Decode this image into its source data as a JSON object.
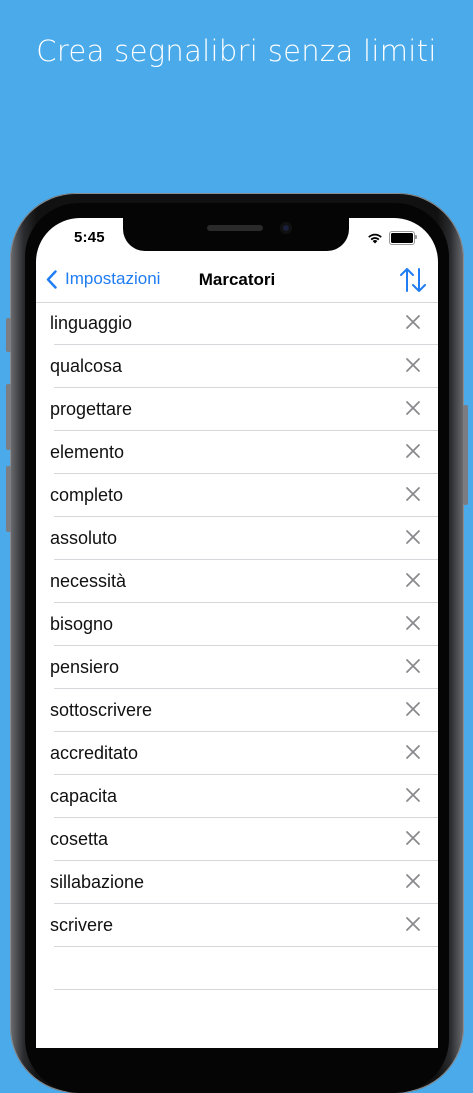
{
  "headline": "Crea segnalibri senza limiti",
  "status_bar": {
    "time": "5:45"
  },
  "nav": {
    "back_label": "Impostazioni",
    "title": "Marcatori",
    "sort_icon": "sort-arrows-icon"
  },
  "bookmarks": [
    "linguaggio",
    "qualcosa",
    "progettare",
    "elemento",
    "completo",
    "assoluto",
    "necessità",
    "bisogno",
    "pensiero",
    "sottoscrivere",
    "accreditato",
    "capacita",
    "cosetta",
    "sillabazione",
    "scrivere"
  ],
  "colors": {
    "background": "#4aaaea",
    "accent": "#1f7cf2",
    "delete_icon": "#8a8a8e"
  }
}
